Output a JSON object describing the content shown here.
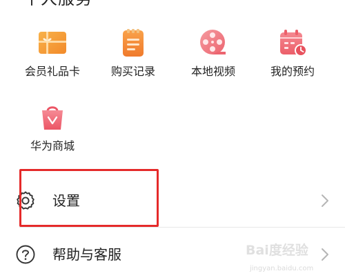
{
  "section": {
    "title": "个人服务"
  },
  "grid": {
    "items": [
      {
        "label": "会员礼品卡",
        "icon": "gift-card-icon",
        "color": "#F5A03C"
      },
      {
        "label": "购买记录",
        "icon": "purchase-record-icon",
        "color": "#F48A3A"
      },
      {
        "label": "本地视频",
        "icon": "film-reel-icon",
        "color": "#F07F86"
      },
      {
        "label": "我的预约",
        "icon": "calendar-clock-icon",
        "color": "#EE6A74"
      },
      {
        "label": "华为商城",
        "icon": "shopping-bag-icon",
        "color": "#F0697A"
      }
    ]
  },
  "list": {
    "settings": {
      "label": "设置",
      "icon": "gear-icon"
    },
    "help": {
      "label": "帮助与客服",
      "icon": "question-circle-icon"
    }
  },
  "watermark": {
    "brand": "Bai度经验",
    "url": "jingyan.baidu.com"
  },
  "colors": {
    "highlight": "#E52A2A",
    "divider": "#E8E8E8",
    "text": "#222222",
    "chevron": "#B5B5B5"
  }
}
